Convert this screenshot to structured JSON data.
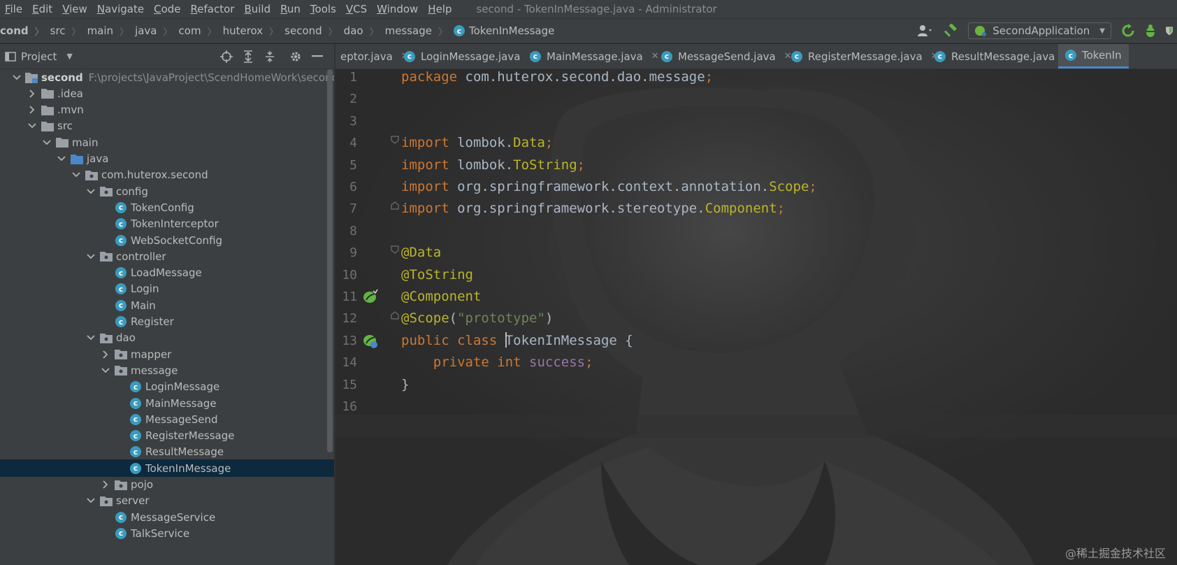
{
  "menu": {
    "items": [
      {
        "u": "F",
        "rest": "ile"
      },
      {
        "u": "E",
        "rest": "dit"
      },
      {
        "u": "V",
        "rest": "iew"
      },
      {
        "u": "N",
        "rest": "avigate"
      },
      {
        "u": "C",
        "rest": "ode"
      },
      {
        "u": "R",
        "rest": "efactor"
      },
      {
        "u": "B",
        "rest": "uild"
      },
      {
        "u": "R",
        "rest": "un"
      },
      {
        "u": "T",
        "rest": "ools"
      },
      {
        "u": "V",
        "rest": "CS"
      },
      {
        "u": "W",
        "rest": "indow"
      },
      {
        "u": "H",
        "rest": "elp"
      }
    ],
    "window_title": "second - TokenInMessage.java - Administrator"
  },
  "breadcrumbs": [
    "cond",
    "src",
    "main",
    "java",
    "com",
    "huterox",
    "second",
    "dao",
    "message",
    "TokenInMessage"
  ],
  "run_config": {
    "label": "SecondApplication"
  },
  "project_panel": {
    "title": "Project"
  },
  "tree": [
    {
      "label": "second",
      "path": "F:\\projects\\JavaProject\\ScendHomeWork\\second",
      "type": "module",
      "depth": 0,
      "open": true
    },
    {
      "label": ".idea",
      "type": "folder",
      "depth": 1,
      "open": false
    },
    {
      "label": ".mvn",
      "type": "folder",
      "depth": 1,
      "open": false
    },
    {
      "label": "src",
      "type": "folder",
      "depth": 1,
      "open": true
    },
    {
      "label": "main",
      "type": "folder",
      "depth": 2,
      "open": true
    },
    {
      "label": "java",
      "type": "src-folder",
      "depth": 3,
      "open": true
    },
    {
      "label": "com.huterox.second",
      "type": "package",
      "depth": 4,
      "open": true
    },
    {
      "label": "config",
      "type": "package",
      "depth": 5,
      "open": true
    },
    {
      "label": "TokenConfig",
      "type": "class",
      "depth": 6
    },
    {
      "label": "TokenInterceptor",
      "type": "class",
      "depth": 6
    },
    {
      "label": "WebSocketConfig",
      "type": "class",
      "depth": 6
    },
    {
      "label": "controller",
      "type": "package",
      "depth": 5,
      "open": true
    },
    {
      "label": "LoadMessage",
      "type": "class",
      "depth": 6
    },
    {
      "label": "Login",
      "type": "class",
      "depth": 6
    },
    {
      "label": "Main",
      "type": "class",
      "depth": 6
    },
    {
      "label": "Register",
      "type": "class",
      "depth": 6
    },
    {
      "label": "dao",
      "type": "package",
      "depth": 5,
      "open": true
    },
    {
      "label": "mapper",
      "type": "package",
      "depth": 6,
      "open": false
    },
    {
      "label": "message",
      "type": "package",
      "depth": 6,
      "open": true
    },
    {
      "label": "LoginMessage",
      "type": "class",
      "depth": 7
    },
    {
      "label": "MainMessage",
      "type": "class",
      "depth": 7
    },
    {
      "label": "MessageSend",
      "type": "class",
      "depth": 7
    },
    {
      "label": "RegisterMessage",
      "type": "class",
      "depth": 7
    },
    {
      "label": "ResultMessage",
      "type": "class",
      "depth": 7
    },
    {
      "label": "TokenInMessage",
      "type": "class",
      "depth": 7,
      "selected": true
    },
    {
      "label": "pojo",
      "type": "package",
      "depth": 6,
      "open": false
    },
    {
      "label": "server",
      "type": "package",
      "depth": 5,
      "open": true
    },
    {
      "label": "MessageService",
      "type": "class",
      "depth": 6
    },
    {
      "label": "TalkService",
      "type": "class",
      "depth": 6
    }
  ],
  "tabs": [
    {
      "label": "eptor.java",
      "icon": false,
      "active": false
    },
    {
      "label": "LoginMessage.java",
      "icon": true,
      "active": false
    },
    {
      "label": "MainMessage.java",
      "icon": true,
      "active": false
    },
    {
      "label": "MessageSend.java",
      "icon": true,
      "active": false
    },
    {
      "label": "RegisterMessage.java",
      "icon": true,
      "active": false
    },
    {
      "label": "ResultMessage.java",
      "icon": true,
      "active": false
    },
    {
      "label": "TokenIn",
      "icon": true,
      "active": true
    }
  ],
  "code_lines": [
    {
      "n": "1",
      "tokens": [
        [
          "kw",
          "package "
        ],
        [
          "t",
          "com.huterox.second.dao.message"
        ],
        [
          "kw",
          ";"
        ]
      ]
    },
    {
      "n": "2",
      "tokens": []
    },
    {
      "n": "3",
      "tokens": []
    },
    {
      "n": "4",
      "tokens": [
        [
          "kw",
          "import "
        ],
        [
          "t",
          "lombok."
        ],
        [
          "an",
          "Data"
        ],
        [
          "kw",
          ";"
        ]
      ],
      "fold": "open"
    },
    {
      "n": "5",
      "tokens": [
        [
          "kw",
          "import "
        ],
        [
          "t",
          "lombok."
        ],
        [
          "an",
          "ToString"
        ],
        [
          "kw",
          ";"
        ]
      ]
    },
    {
      "n": "6",
      "tokens": [
        [
          "kw",
          "import "
        ],
        [
          "t",
          "org.springframework.context.annotation."
        ],
        [
          "an",
          "Scope"
        ],
        [
          "kw",
          ";"
        ]
      ]
    },
    {
      "n": "7",
      "tokens": [
        [
          "kw",
          "import "
        ],
        [
          "t",
          "org.springframework.stereotype."
        ],
        [
          "an",
          "Component"
        ],
        [
          "kw",
          ";"
        ]
      ],
      "fold": "close"
    },
    {
      "n": "8",
      "tokens": []
    },
    {
      "n": "9",
      "tokens": [
        [
          "an",
          "@Data"
        ]
      ],
      "fold": "open"
    },
    {
      "n": "10",
      "tokens": [
        [
          "an",
          "@ToString"
        ]
      ]
    },
    {
      "n": "11",
      "tokens": [
        [
          "an",
          "@Component"
        ]
      ],
      "gutter": "bean"
    },
    {
      "n": "12",
      "tokens": [
        [
          "an",
          "@Scope"
        ],
        [
          "t",
          "("
        ],
        [
          "st",
          "\"prototype\""
        ],
        [
          "t",
          ")"
        ]
      ],
      "fold": "close"
    },
    {
      "n": "13",
      "tokens": [
        [
          "kw",
          "public class "
        ],
        [
          "caret",
          ""
        ],
        [
          "t",
          "TokenInMessage {"
        ]
      ],
      "gutter": "bean-class"
    },
    {
      "n": "14",
      "tokens": [
        [
          "t",
          "    "
        ],
        [
          "kw",
          "private int "
        ],
        [
          "fld",
          "success"
        ],
        [
          "kw",
          ";"
        ]
      ]
    },
    {
      "n": "15",
      "tokens": [
        [
          "t",
          "}"
        ]
      ]
    },
    {
      "n": "16",
      "tokens": []
    }
  ],
  "watermark": "@稀土掘金技术社区",
  "colors": {
    "keyword": "#cc7832",
    "annotation": "#bbb529",
    "string": "#6a8759",
    "field": "#9876aa",
    "text": "#a9b7c6",
    "selection": "#0d293e",
    "class_icon": "#3a9bbf"
  }
}
